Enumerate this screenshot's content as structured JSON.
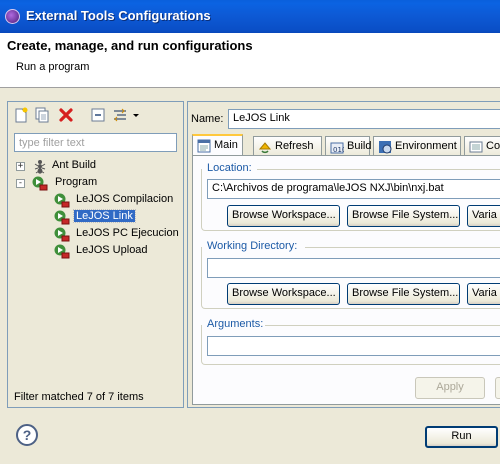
{
  "window": {
    "title": "External Tools Configurations"
  },
  "header": {
    "title": "Create, manage, and run configurations",
    "subtitle": "Run a program"
  },
  "left_toolbar": {
    "icons": [
      "new-launch-config-icon",
      "duplicate-icon",
      "delete-icon",
      "collapse-all-icon",
      "filter-icon",
      "dropdown-arrow-icon"
    ]
  },
  "filter": {
    "placeholder": "type filter text",
    "value": ""
  },
  "tree": {
    "items": [
      {
        "label": "Ant Build",
        "level": 0,
        "expander": "+",
        "icon": "ant-icon"
      },
      {
        "label": "Program",
        "level": 0,
        "expander": "-",
        "icon": "program-icon"
      },
      {
        "label": "LeJOS Compilacion",
        "level": 1,
        "icon": "program-config-icon"
      },
      {
        "label": "LeJOS Link",
        "level": 1,
        "icon": "program-config-icon",
        "selected": true
      },
      {
        "label": "LeJOS PC Ejecucion",
        "level": 1,
        "icon": "program-config-icon"
      },
      {
        "label": "LeJOS Upload",
        "level": 1,
        "icon": "program-config-icon"
      }
    ],
    "status": "Filter matched 7 of 7 items"
  },
  "config": {
    "name_label": "Name:",
    "name_value": "LeJOS Link",
    "tabs": [
      {
        "label": "Main",
        "icon": "main-tab-icon",
        "active": true
      },
      {
        "label": "Refresh",
        "icon": "refresh-icon"
      },
      {
        "label": "Build",
        "icon": "build-icon"
      },
      {
        "label": "Environment",
        "icon": "environment-icon"
      },
      {
        "label": "Com",
        "icon": "common-icon"
      }
    ],
    "location": {
      "label": "Location:",
      "value": "C:\\Archivos de programa\\leJOS NXJ\\bin\\nxj.bat",
      "buttons": [
        "Browse Workspace...",
        "Browse File System...",
        "Varia"
      ]
    },
    "working_directory": {
      "label": "Working Directory:",
      "value": "",
      "buttons": [
        "Browse Workspace...",
        "Browse File System...",
        "Varia"
      ]
    },
    "arguments": {
      "label": "Arguments:",
      "value": ""
    },
    "apply_label": "Apply"
  },
  "footer": {
    "help_label": "?",
    "run_label": "Run"
  },
  "colors": {
    "titlebar": "#0a5fdc",
    "selection": "#316ac5",
    "group_label": "#1c5aa6",
    "active_tab_top": "#ffc83c"
  }
}
